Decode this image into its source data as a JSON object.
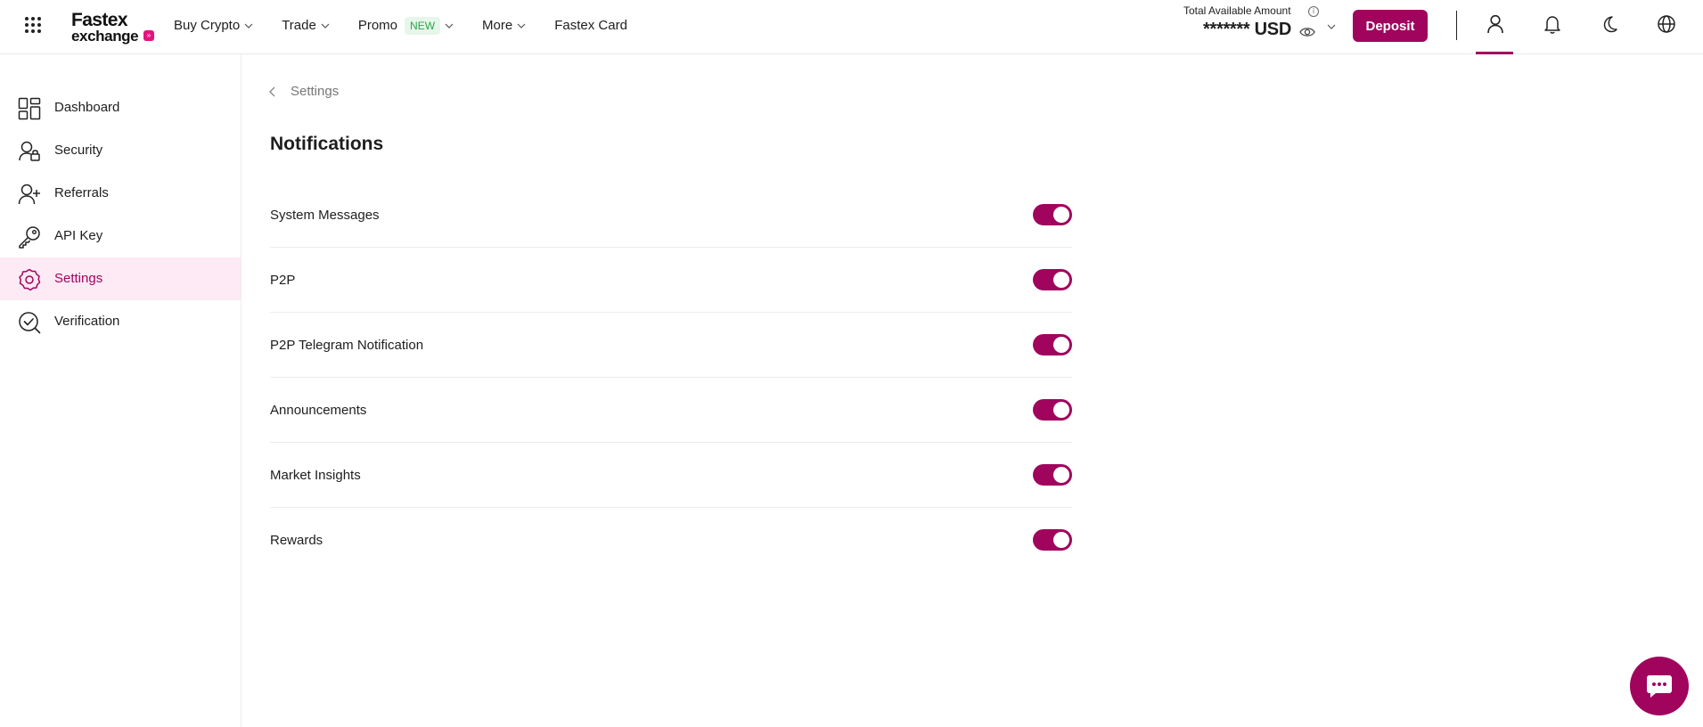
{
  "brand": {
    "line1": "Fastex",
    "line2": "exchange",
    "dot": "»"
  },
  "nav": {
    "buy_crypto": "Buy Crypto",
    "trade": "Trade",
    "promo": "Promo",
    "promo_badge": "NEW",
    "more": "More",
    "fastex_card": "Fastex Card"
  },
  "balance": {
    "label": "Total Available Amount",
    "info": "i",
    "value": "******* USD"
  },
  "actions": {
    "deposit": "Deposit"
  },
  "sidebar": {
    "items": [
      {
        "label": "Dashboard",
        "icon": "dashboard-icon"
      },
      {
        "label": "Security",
        "icon": "security-icon"
      },
      {
        "label": "Referrals",
        "icon": "referrals-icon"
      },
      {
        "label": "API Key",
        "icon": "key-icon"
      },
      {
        "label": "Settings",
        "icon": "settings-icon",
        "active": true
      },
      {
        "label": "Verification",
        "icon": "verification-icon"
      }
    ]
  },
  "breadcrumb": {
    "label": "Settings"
  },
  "page": {
    "title": "Notifications"
  },
  "notifications": [
    {
      "label": "System Messages",
      "enabled": true
    },
    {
      "label": "P2P",
      "enabled": true
    },
    {
      "label": "P2P Telegram Notification",
      "enabled": true
    },
    {
      "label": "Announcements",
      "enabled": true
    },
    {
      "label": "Market Insights",
      "enabled": true
    },
    {
      "label": "Rewards",
      "enabled": true
    }
  ],
  "colors": {
    "accent": "#a0045d",
    "accent_light": "#fdeaf4",
    "new_badge_bg": "#e6f6ea",
    "new_badge_text": "#27a84a"
  }
}
